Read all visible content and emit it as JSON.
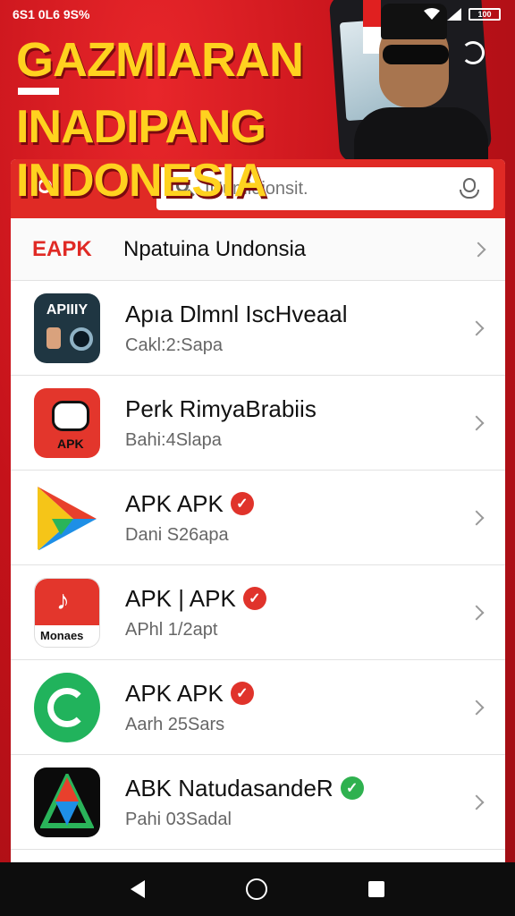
{
  "status_bar": {
    "left": "6S1 0L6 9S%",
    "battery": "100"
  },
  "header": {
    "headline_1": "GAZMIARAN",
    "headline_2": "INADIPANG INDONESIA"
  },
  "search": {
    "placeholder": "IUumloionsit."
  },
  "category": {
    "tag": "EAPK",
    "title": "Npatuina Undonsia"
  },
  "apps": [
    {
      "name": "Apıa Dlmnl IscHveaal",
      "sub": "Cakl:2:Sapa",
      "verified": false,
      "icon_label": "APIIIY",
      "icon_bg": "#1f3642"
    },
    {
      "name": "Perk RimyaBrabiis",
      "sub": "Bahi:4Slapa",
      "verified": false,
      "icon_label": "APK",
      "icon_bg": "#e3362c"
    },
    {
      "name": "APK APK",
      "sub": "Dani S26apa",
      "verified": true,
      "icon_label": "",
      "icon_bg": "#ffffff"
    },
    {
      "name": "APK | APK",
      "sub": "APhl 1/2apt",
      "verified": true,
      "icon_label": "Monaes",
      "icon_bg": "#e3362c"
    },
    {
      "name": "APK APK",
      "sub": "Aarh 25Sars",
      "verified": true,
      "icon_label": "",
      "icon_bg": "#21b35c"
    },
    {
      "name": "ABK NatudasandeR",
      "sub": "Pahi 03Sadal",
      "verified": true,
      "icon_label": "",
      "icon_bg": "#0b0b0b"
    }
  ],
  "colors": {
    "accent": "#e02a25",
    "verified_red": "#e0332b",
    "verified_green": "#2fb14f"
  }
}
